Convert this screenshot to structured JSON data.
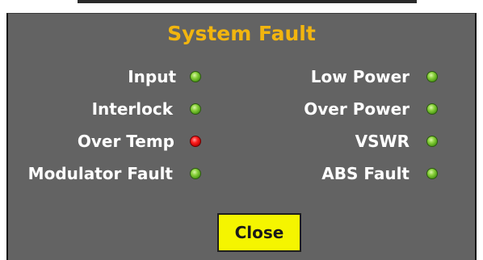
{
  "dialog": {
    "title": "System Fault",
    "close_label": "Close"
  },
  "indicators": {
    "left": [
      {
        "label": "Input",
        "status": "ok"
      },
      {
        "label": "Interlock",
        "status": "ok"
      },
      {
        "label": "Over Temp",
        "status": "fault"
      },
      {
        "label": "Modulator Fault",
        "status": "ok"
      }
    ],
    "right": [
      {
        "label": "Low Power",
        "status": "ok"
      },
      {
        "label": "Over Power",
        "status": "ok"
      },
      {
        "label": "VSWR",
        "status": "ok"
      },
      {
        "label": "ABS Fault",
        "status": "ok"
      }
    ]
  },
  "colors": {
    "title": "#f2b50f",
    "panel": "#636363",
    "led_ok": "#6fbf2a",
    "led_fault": "#e60000",
    "button": "#f5f500"
  }
}
